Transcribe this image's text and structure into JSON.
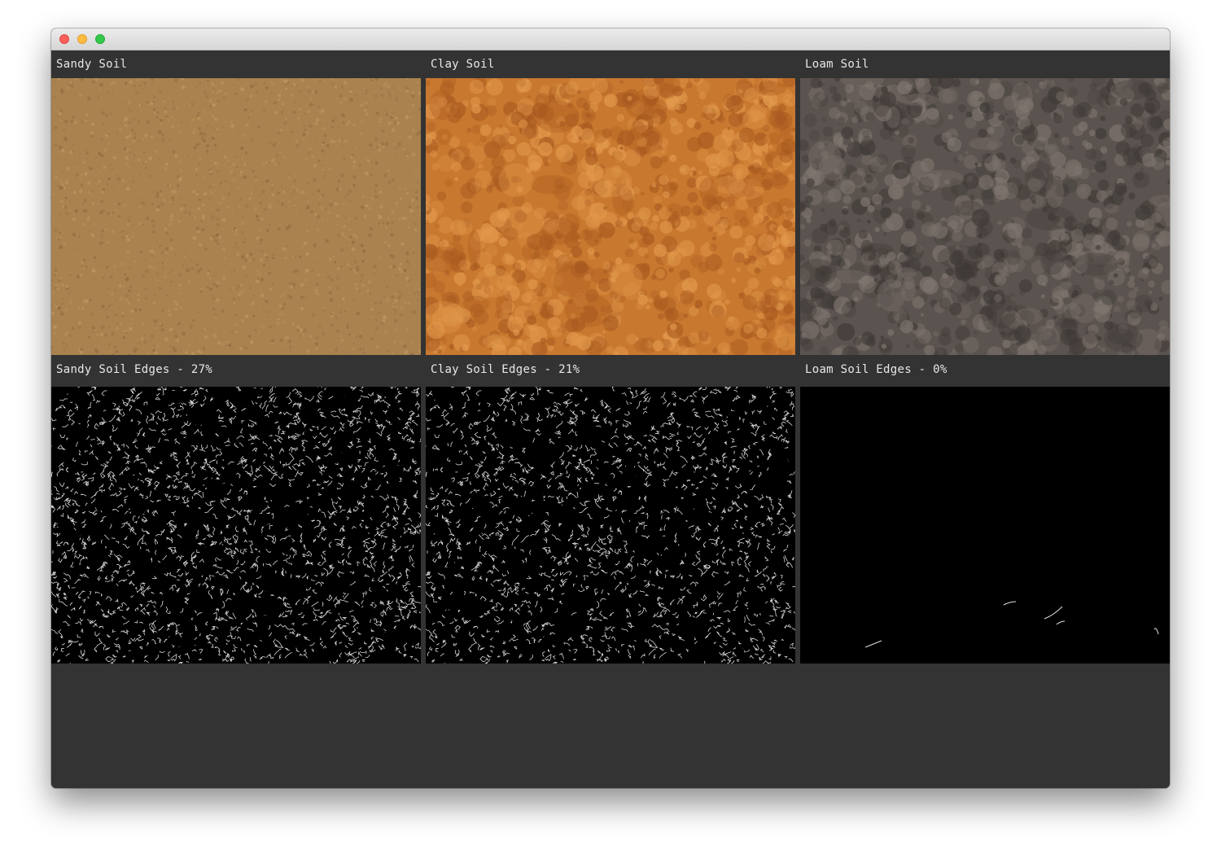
{
  "window": {
    "controls": [
      "close-button",
      "minimize-button",
      "maximize-button"
    ]
  },
  "panels": [
    {
      "label": "Sandy Soil",
      "kind": "photo",
      "texture": "sandy",
      "colors": [
        "#a9824f",
        "#8d6b3f",
        "#c29a63"
      ]
    },
    {
      "label": "Clay Soil",
      "kind": "photo",
      "texture": "clay",
      "colors": [
        "#c9782f",
        "#a85a20",
        "#e29a4d"
      ]
    },
    {
      "label": "Loam Soil",
      "kind": "photo",
      "texture": "loam",
      "colors": [
        "#5b534f",
        "#3f3a37",
        "#807670"
      ]
    },
    {
      "label": "Sandy Soil Edges - 27%",
      "kind": "edges",
      "edge_fraction": 0.27
    },
    {
      "label": "Clay Soil Edges - 21%",
      "kind": "edges",
      "edge_fraction": 0.21
    },
    {
      "label": "Loam Soil Edges - 0%",
      "kind": "edges",
      "edge_fraction": 0.0
    }
  ],
  "theme": {
    "background": "#333333",
    "label_color": "#e8e8e8"
  }
}
